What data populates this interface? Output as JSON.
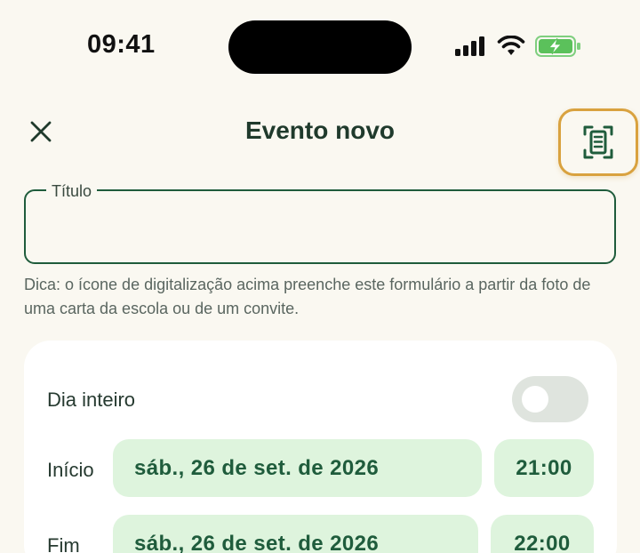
{
  "status_bar": {
    "time": "09:41",
    "icons": [
      "signal-icon",
      "wifi-icon",
      "battery-charging-icon"
    ]
  },
  "header": {
    "title": "Evento novo",
    "close_icon": "close-icon",
    "scan_icon": "document-scan-icon"
  },
  "form": {
    "title_label": "Título",
    "title_value": "",
    "hint": "Dica: o ícone de digitalização acima preenche este formulário a partir da foto de uma carta da escola ou de um convite."
  },
  "schedule": {
    "all_day_label": "Dia inteiro",
    "all_day_on": false,
    "start": {
      "label": "Início",
      "date": "sáb., 26 de set. de 2026",
      "time": "21:00"
    },
    "end": {
      "label": "Fim",
      "date": "sáb., 26 de set. de 2026",
      "time": "22:00"
    }
  },
  "colors": {
    "background": "#faf8f1",
    "primary": "#1f5c3c",
    "pill_bg": "#def4dd",
    "highlight": "#d9a23f",
    "battery": "#5bc15b"
  }
}
